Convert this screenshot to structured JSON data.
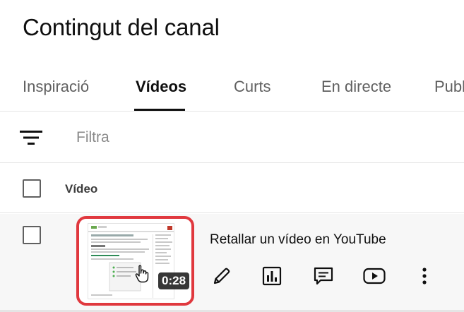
{
  "page": {
    "title": "Contingut del canal"
  },
  "tabs": [
    {
      "label": "Inspiració",
      "active": false
    },
    {
      "label": "Vídeos",
      "active": true
    },
    {
      "label": "Curts",
      "active": false
    },
    {
      "label": "En directe",
      "active": false
    },
    {
      "label": "Publ",
      "active": false
    }
  ],
  "filter": {
    "placeholder": "Filtra",
    "icon": "filter-icon"
  },
  "table": {
    "column_video": "Vídeo"
  },
  "video": {
    "title": "Retallar un vídeo en YouTube",
    "duration": "0:28",
    "actions": [
      "pencil-icon",
      "analytics-icon",
      "comments-icon",
      "youtube-play-icon",
      "more-vert-icon"
    ]
  },
  "colors": {
    "accent_red": "#e0383e",
    "active_tab": "#0f0f0f",
    "inactive_tab": "#606060"
  }
}
